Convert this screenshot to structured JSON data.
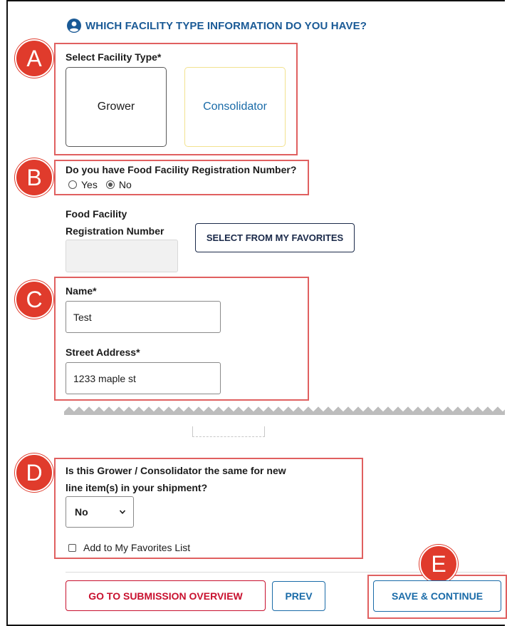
{
  "header": {
    "title": "WHICH FACILITY TYPE INFORMATION DO YOU HAVE?",
    "icon": "user-circle-icon",
    "color": "#1a5a96"
  },
  "annotations": {
    "a": "A",
    "b": "B",
    "c": "C",
    "d": "D",
    "e": "E",
    "color": "#e03b2c"
  },
  "facility_type": {
    "label": "Select Facility Type*",
    "options": [
      {
        "label": "Grower"
      },
      {
        "label": "Consolidator"
      }
    ]
  },
  "ffr": {
    "question": "Do you have Food Facility Registration Number?",
    "yes_label": "Yes",
    "no_label": "No",
    "selected": "No",
    "field_label_line1": "Food Facility",
    "field_label_line2": "Registration Number",
    "field_value": "",
    "favorites_button": "SELECT FROM MY FAVORITES"
  },
  "facility": {
    "name_label": "Name*",
    "name_value": "Test",
    "street_label": "Street Address*",
    "street_value": "1233 maple st"
  },
  "same_for_new": {
    "question_line1": "Is this Grower / Consolidator the same for new",
    "question_line2": "line item(s) in your shipment?",
    "selected": "No",
    "favorites_checkbox": "Add to My Favorites List"
  },
  "actions": {
    "overview": "GO TO SUBMISSION OVERVIEW",
    "prev": "PREV",
    "save": "SAVE & CONTINUE"
  }
}
